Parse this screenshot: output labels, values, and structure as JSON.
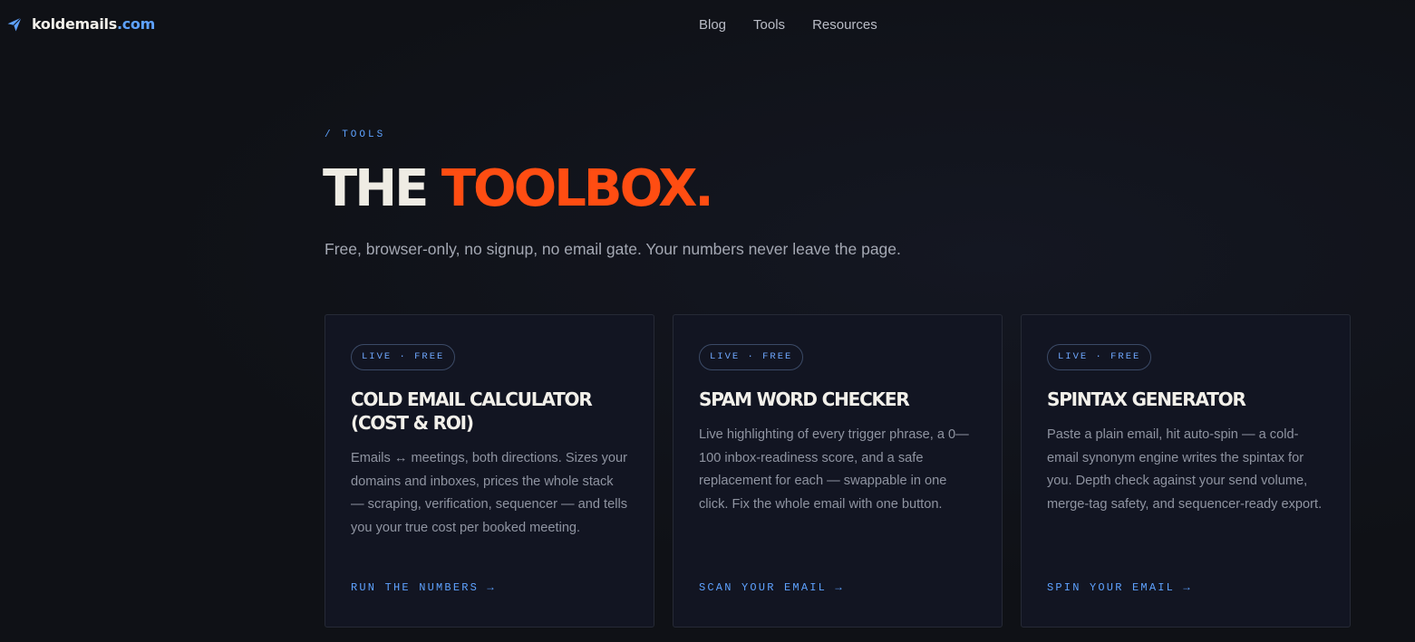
{
  "header": {
    "logo": {
      "name": "koldemails",
      "tld": ".com",
      "icon": "paper-plane-icon"
    },
    "nav": [
      {
        "label": "Blog"
      },
      {
        "label": "Tools"
      },
      {
        "label": "Resources"
      }
    ]
  },
  "hero": {
    "eyebrow": "/ TOOLS",
    "title_part1": "THE ",
    "title_part2": "TOOLBOX.",
    "subtitle": "Free, browser-only, no signup, no email gate. Your numbers never leave the page."
  },
  "cards": [
    {
      "badge": "LIVE · FREE",
      "title": "COLD EMAIL CALCULATOR (COST & ROI)",
      "description": "Emails ↔ meetings, both directions. Sizes your domains and inboxes, prices the whole stack — scraping, verification, sequencer — and tells you your true cost per booked meeting.",
      "cta": "RUN THE NUMBERS →"
    },
    {
      "badge": "LIVE · FREE",
      "title": "SPAM WORD CHECKER",
      "description": "Live highlighting of every trigger phrase, a 0—100 inbox-readiness score, and a safe replacement for each — swappable in one click. Fix the whole email with one button.",
      "cta": "SCAN YOUR EMAIL →"
    },
    {
      "badge": "LIVE · FREE",
      "title": "SPINTAX GENERATOR",
      "description": "Paste a plain email, hit auto-spin — a cold-email synonym engine writes the spintax for you. Depth check against your send volume, merge-tag safety, and sequencer-ready export.",
      "cta": "SPIN YOUR EMAIL →"
    }
  ],
  "colors": {
    "background": "#0f1116",
    "accent_orange": "#ff4d12",
    "accent_blue": "#5ea2ff",
    "card_background": "#121522"
  }
}
